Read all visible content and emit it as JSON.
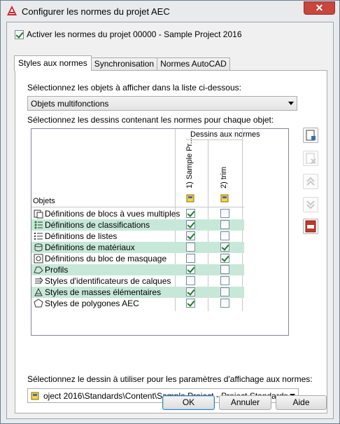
{
  "window": {
    "title": "Configurer les normes du projet AEC",
    "close_label": "✕"
  },
  "activate": {
    "label": "Activer les normes du projet 00000 - Sample Project 2016",
    "checked": true
  },
  "tabs": [
    {
      "label": "Styles aux normes",
      "active": true
    },
    {
      "label": "Synchronisation",
      "active": false
    },
    {
      "label": "Normes AutoCAD",
      "active": false
    }
  ],
  "panel": {
    "select_objects_label": "Sélectionnez les objets à afficher dans la liste ci-dessous:",
    "object_type_value": "Objets multifonctions",
    "select_drawings_label": "Sélectionnez les dessins contenant les normes pour chaque objet:",
    "grid": {
      "group_header": "Dessins aux normes",
      "column1": "1) Sample Pr...",
      "column2": "2) trim",
      "objects_header": "Objets",
      "rows": [
        {
          "label": "Définitions de blocs à vues multiples",
          "c1": true,
          "c2": false,
          "highlight": false,
          "icon": "multiview-block-icon"
        },
        {
          "label": "Définitions de classifications",
          "c1": true,
          "c2": false,
          "highlight": true,
          "icon": "classification-icon"
        },
        {
          "label": "Définitions de listes",
          "c1": true,
          "c2": false,
          "highlight": false,
          "icon": "list-icon"
        },
        {
          "label": "Définitions de matériaux",
          "c1": false,
          "c2": true,
          "highlight": true,
          "icon": "material-icon"
        },
        {
          "label": "Définitions du bloc de masquage",
          "c1": false,
          "c2": true,
          "highlight": false,
          "icon": "mask-block-icon"
        },
        {
          "label": "Profils",
          "c1": true,
          "c2": false,
          "highlight": true,
          "icon": "profile-icon"
        },
        {
          "label": "Styles d'identificateurs de calques",
          "c1": false,
          "c2": false,
          "highlight": false,
          "icon": "layer-key-icon"
        },
        {
          "label": "Styles de masses élémentaires",
          "c1": true,
          "c2": false,
          "highlight": true,
          "icon": "mass-element-icon"
        },
        {
          "label": "Styles de polygones AEC",
          "c1": true,
          "c2": false,
          "highlight": false,
          "icon": "polygon-icon"
        }
      ]
    },
    "display_drawing_label": "Sélectionnez le dessin à utiliser pour les paramètres d'affichage aux normes:",
    "display_drawing_value": "oject 2016\\Standards\\Content\\Sample Project - Project Standards.dwg"
  },
  "side_buttons": [
    {
      "icon": "add-drawing-icon",
      "enabled": true
    },
    {
      "icon": "remove-drawing-icon",
      "enabled": false
    },
    {
      "icon": "move-up-icon",
      "enabled": false
    },
    {
      "icon": "move-down-icon",
      "enabled": false
    },
    {
      "icon": "report-icon",
      "enabled": true
    }
  ],
  "buttons": {
    "ok": "OK",
    "cancel": "Annuler",
    "help": "Aide"
  },
  "colors": {
    "row_highlight": "#c7e8d8",
    "check_mark": "#1e7b2e",
    "title_close": "#c7463e"
  }
}
